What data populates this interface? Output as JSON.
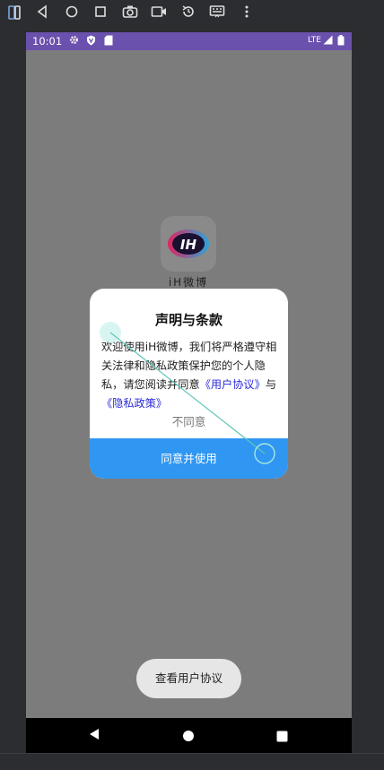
{
  "emulator": {
    "toolbar_icons": [
      "fold-icon",
      "back-icon",
      "home-icon",
      "overview-icon",
      "camera-icon",
      "video-icon",
      "rotate-icon",
      "keyboard-icon",
      "more-icon"
    ]
  },
  "status_bar": {
    "time": "10:01",
    "network": "LTE",
    "icons": [
      "gear-icon",
      "shield-icon",
      "sd-card-icon",
      "signal-icon",
      "battery-icon"
    ],
    "color": "#6a51ad"
  },
  "home": {
    "app_label": "iH微博"
  },
  "dialog": {
    "title": "声明与条款",
    "body_text": "欢迎使用iH微博，我们将严格遵守相关法律和隐私政策保护您的个人隐私，请您阅读并同意",
    "link_user_agreement": "《用户协议》",
    "and_text": "与",
    "link_privacy_policy": "《隐私政策》",
    "disagree_label": "不同意",
    "agree_label": "同意并使用",
    "accent_color": "#2f96f2"
  },
  "toast": {
    "text": "查看用户协议"
  },
  "nav_bar": {
    "icons": [
      "back-triangle-icon",
      "home-circle-icon",
      "recents-square-icon"
    ]
  }
}
